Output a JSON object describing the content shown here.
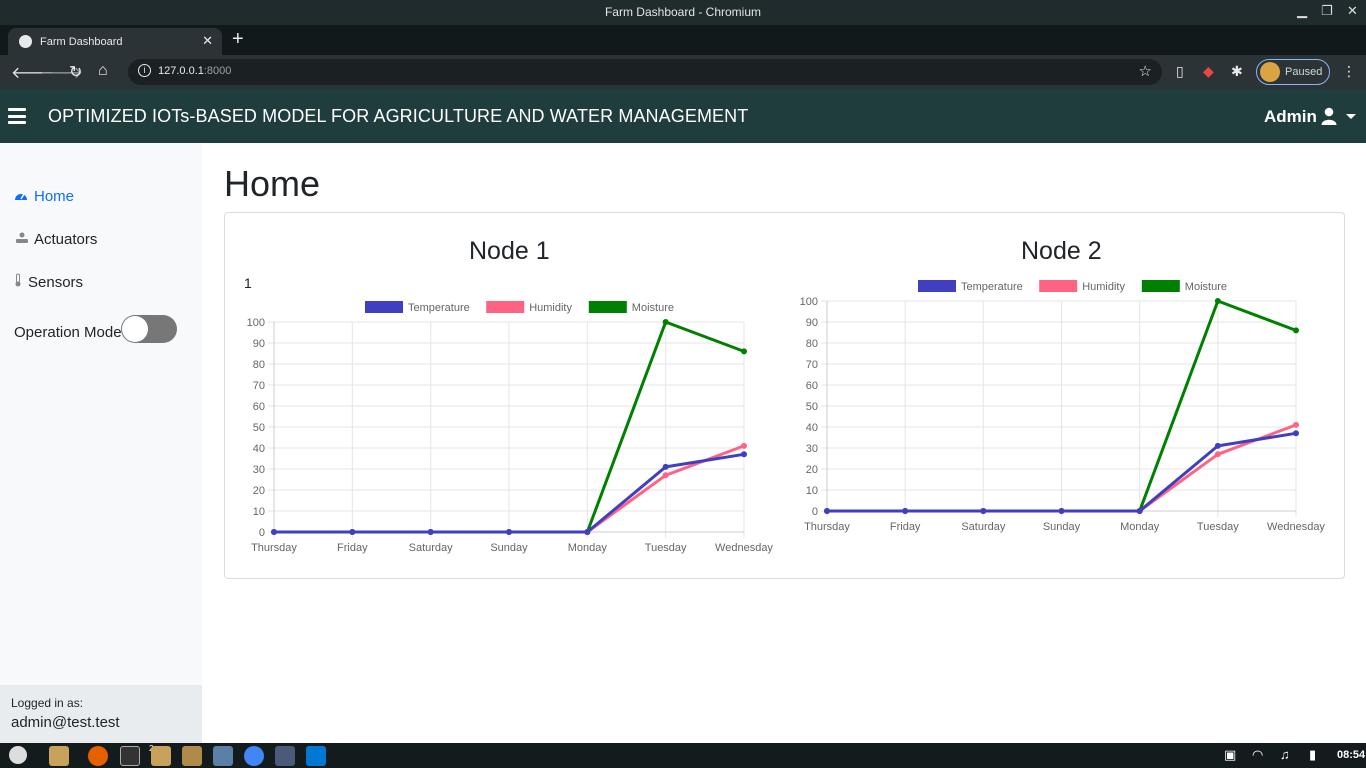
{
  "window": {
    "title": "Farm Dashboard - Chromium",
    "tab_title": "Farm Dashboard",
    "url_host": "127.0.0.1",
    "url_port": ":8000",
    "profile_status": "Paused"
  },
  "navbar": {
    "brand": "OPTIMIZED IOTs-BASED MODEL FOR AGRICULTURE AND WATER MANAGEMENT",
    "user": "Admin"
  },
  "sidebar": {
    "items": [
      {
        "label": "Home",
        "icon": "dashboard-icon",
        "active": true
      },
      {
        "label": "Actuators",
        "icon": "actuator-icon",
        "active": false
      },
      {
        "label": "Sensors",
        "icon": "thermometer-icon",
        "active": false
      }
    ],
    "operation_mode_label": "Operation Mode",
    "operation_mode_on": false,
    "logged_in_label": "Logged in as:",
    "logged_in_user": "admin@test.test"
  },
  "page": {
    "title": "Home"
  },
  "colors": {
    "temperature": "#3f3fbf",
    "humidity": "#ff6384",
    "moisture": "#008000",
    "navbar_bg": "#1f3d3c"
  },
  "chart_data": [
    {
      "type": "line",
      "title": "Node 1",
      "extra_label": "1",
      "categories": [
        "Thursday",
        "Friday",
        "Saturday",
        "Sunday",
        "Monday",
        "Tuesday",
        "Wednesday"
      ],
      "series": [
        {
          "name": "Temperature",
          "values": [
            0,
            0,
            0,
            0,
            0,
            31,
            37
          ]
        },
        {
          "name": "Humidity",
          "values": [
            0,
            0,
            0,
            0,
            0,
            27,
            41
          ]
        },
        {
          "name": "Moisture",
          "values": [
            0,
            0,
            0,
            0,
            0,
            100,
            86
          ]
        }
      ],
      "ylim": [
        0,
        100
      ],
      "yticks": [
        0,
        10,
        20,
        30,
        40,
        50,
        60,
        70,
        80,
        90,
        100
      ],
      "grid": true,
      "legend": "top"
    },
    {
      "type": "line",
      "title": "Node 2",
      "extra_label": "",
      "categories": [
        "Thursday",
        "Friday",
        "Saturday",
        "Sunday",
        "Monday",
        "Tuesday",
        "Wednesday"
      ],
      "series": [
        {
          "name": "Temperature",
          "values": [
            0,
            0,
            0,
            0,
            0,
            31,
            37
          ]
        },
        {
          "name": "Humidity",
          "values": [
            0,
            0,
            0,
            0,
            0,
            27,
            41
          ]
        },
        {
          "name": "Moisture",
          "values": [
            0,
            0,
            0,
            0,
            0,
            100,
            86
          ]
        }
      ],
      "ylim": [
        0,
        100
      ],
      "yticks": [
        0,
        10,
        20,
        30,
        40,
        50,
        60,
        70,
        80,
        90,
        100
      ],
      "grid": true,
      "legend": "top"
    }
  ],
  "taskbar": {
    "clock": "08:54",
    "terminal_badge": "2"
  }
}
